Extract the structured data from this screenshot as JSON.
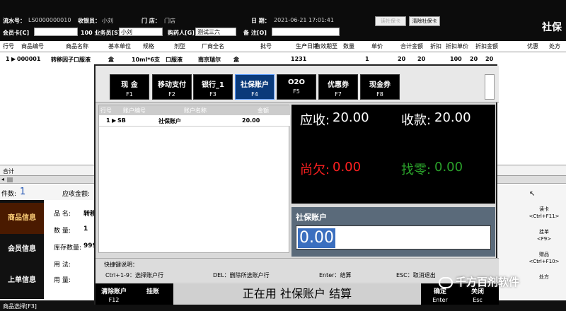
{
  "header": {
    "serial_label": "流水号：",
    "serial_value": "LS0000000010",
    "cashier_label": "收银员：",
    "cashier_value": "小刘",
    "store_label": "门  店：",
    "store_value": "门店",
    "date_label": "日  期：",
    "date_value": "2021-06-21 17:01:41",
    "read_card_label": "读社保卡",
    "clear_card_label": "清除社保卡",
    "brand_partial": "社保",
    "member_card_label": "会员卡[C]",
    "member_card_value": "",
    "salesperson_label": "100 业务员[S]",
    "salesperson_value": "小刘",
    "buyer_label": "购药人[G]",
    "buyer_value": "测试三六",
    "remark_label": "备  注[O]",
    "remark_value": ""
  },
  "grid": {
    "columns": [
      "行号",
      "商品编号",
      "商品名称",
      "基本单位",
      "规格",
      "剂型",
      "厂商全名",
      "",
      "批号",
      "生产日期",
      "有效期至",
      "数量",
      "单价",
      "合计金额",
      "折扣",
      "折扣单价",
      "折扣金额",
      "优惠",
      "处方"
    ],
    "row": [
      "1",
      "000001",
      "转移因子口服液",
      "盒",
      "10ml*6支",
      "口服液",
      "南京瑞尔",
      "盒",
      "1231",
      "",
      "",
      "1",
      "20",
      "20",
      "100",
      "20",
      "20",
      "",
      ""
    ],
    "sum_label": "合计"
  },
  "infobar": {
    "count_label": "件数:",
    "count_value": "1",
    "due_label": "应收金额:"
  },
  "nav": [
    "商品信息",
    "会员信息",
    "上单信息"
  ],
  "detail": {
    "name_label": "品    名:",
    "name_value": "转移",
    "qty_label": "数    量:",
    "qty_value": "1",
    "stock_label": "库存数量:",
    "stock_value": "999",
    "usage_label": "用    法:",
    "dose_label": "用    量:"
  },
  "keypad": [
    {
      "label": "读卡",
      "key": "<Ctrl+F11>"
    },
    {
      "label": "批次",
      "key": "<F9>"
    },
    {
      "label": "挂单",
      "key": "<F9>"
    },
    {
      "label": "处方",
      "key": ""
    },
    {
      "label": "赠品",
      "key": "<Ctrl+F10>"
    },
    {
      "label": "",
      "key": ""
    }
  ],
  "bottombar": {
    "text": "商品选择[F3]"
  },
  "payment": {
    "methods": [
      {
        "label": "现  金",
        "key": "F1"
      },
      {
        "label": "移动支付",
        "key": "F2"
      },
      {
        "label": "银行_1",
        "key": "F3"
      },
      {
        "label": "社保账户",
        "key": "F4"
      },
      {
        "label": "O2O",
        "key": "F5"
      },
      {
        "label": "优惠券",
        "key": "F7"
      },
      {
        "label": "现金券",
        "key": "F8"
      }
    ],
    "account_table": {
      "headers": [
        "行号",
        "账户编号",
        "账户名称",
        "金额"
      ],
      "row": {
        "num": "1",
        "code": "SB",
        "name": "社保账户",
        "amount": "20.00"
      }
    },
    "summary": {
      "receivable_label": "应收:",
      "receivable_value": "20.00",
      "received_label": "收款:",
      "received_value": "20.00",
      "owed_label": "尚欠:",
      "owed_value": "0.00",
      "change_label": "找零:",
      "change_value": "0.00"
    },
    "input": {
      "label": "社保账户",
      "value": "0.00"
    },
    "hints": {
      "title": "快捷键说明：",
      "h1": "Ctrl+1-9：选择账户行",
      "h2": "DEL：删除所选账户行",
      "h3": "Enter：结算",
      "h4": "ESC：取消退出"
    },
    "footer": {
      "clear_label": "清除账户",
      "clear_key": "F12",
      "hold_label": "挂账",
      "status": "正在用 社保账户 结算",
      "ok_label": "确定",
      "ok_key": "Enter",
      "close_label": "关闭",
      "close_key": "Esc"
    }
  },
  "watermark": "千方百剂软件",
  "colors": {
    "accent": "#0a3a7a",
    "owed": "#ff2020",
    "change": "#2aa02a"
  }
}
